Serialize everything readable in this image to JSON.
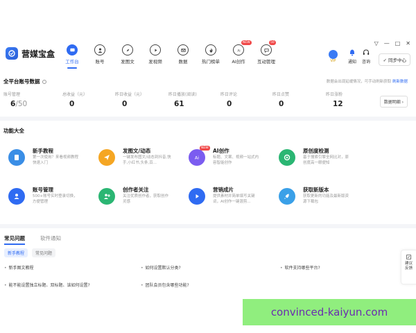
{
  "app": {
    "name": "营媒宝盒"
  },
  "nav": [
    {
      "label": "工作台",
      "icon": "home-monitor-icon",
      "active": true
    },
    {
      "label": "账号",
      "icon": "user-icon"
    },
    {
      "label": "发图文",
      "icon": "compass-icon"
    },
    {
      "label": "发视频",
      "icon": "play-icon"
    },
    {
      "label": "数据",
      "icon": "mail-icon"
    },
    {
      "label": "热门榜单",
      "icon": "fire-icon"
    },
    {
      "label": "AI创作",
      "icon": "ai-icon",
      "badge": "NEW"
    },
    {
      "label": "互动管理",
      "icon": "chat-icon",
      "badge": "50"
    }
  ],
  "toolbar": {
    "window_controls": [
      "▽",
      "—",
      "□",
      "✕"
    ],
    "vip_label": "VIP",
    "notify_label": "通知",
    "consult_label": "咨询",
    "upgrade_label": "✓ 同步中心"
  },
  "stats": {
    "title": "全平台账号数据",
    "note_prefix": "数据会出现延缓情况，可手动刷新获取",
    "note_link": "刷新数据",
    "detail_button": "数据明细 ›",
    "items": [
      {
        "label": "账号管理",
        "value": "6",
        "suffix": "/50",
        "icon": "user-icon"
      },
      {
        "label": "总收益（元）",
        "value": "0",
        "icon": "coin-icon"
      },
      {
        "label": "昨日收益（元）",
        "value": "0",
        "icon": "coin-icon"
      },
      {
        "label": "昨日播放(阅读)",
        "value": "61",
        "icon": "play-icon"
      },
      {
        "label": "昨日评论",
        "value": "0",
        "icon": "comment-icon"
      },
      {
        "label": "昨日点赞",
        "value": "0",
        "icon": "like-icon"
      },
      {
        "label": "昨日涨粉",
        "value": "12",
        "icon": "fans-icon"
      }
    ]
  },
  "features": {
    "title": "功能大全",
    "items": [
      {
        "title": "新手教程",
        "desc": "第一次使用？来看视频教程快速入门",
        "color": "#3a8ee6",
        "icon": "book-icon"
      },
      {
        "title": "发图文/动态",
        "desc": "一键发布图文/动态到抖音,快手,小红书,头条,百...",
        "color": "#f5a623",
        "icon": "send-icon"
      },
      {
        "title": "AI创作",
        "desc": "标题、文案、视频一站式内容智能创作",
        "color": "#7b5cf0",
        "icon": "ai-icon",
        "badge": "NEW"
      },
      {
        "title": "原创度检测",
        "desc": "基于搜索引擎全网比对，原创度高一眼便知",
        "color": "#2bb673",
        "icon": "check-icon"
      },
      {
        "title": "账号管理",
        "desc": "500+账号实时登录切换，方便管理",
        "color": "#2f6bf2",
        "icon": "user-icon"
      },
      {
        "title": "创作者关注",
        "desc": "关注优质创作者，获取创作灵感",
        "color": "#2bb673",
        "icon": "follow-icon"
      },
      {
        "title": "营销成片",
        "desc": "提供素材并简单填写关键词，AI创作一键混剪...",
        "color": "#2f6bf2",
        "icon": "play-icon"
      },
      {
        "title": "获取新版本",
        "desc": "获取更新的功能及最新版资源下载包",
        "color": "#3aa0e8",
        "icon": "rocket-icon"
      }
    ]
  },
  "faq": {
    "tabs": [
      "常见问题",
      "软件通知"
    ],
    "chips": [
      "新手教程",
      "常见问题"
    ],
    "items": [
      "新手图文教程",
      "如何设置默认分类?",
      "软件支持哪些平台?",
      "能不能设置独立标题、双标题、该如何设置?",
      "团队会员包含哪些功能?"
    ]
  },
  "feedback": {
    "label": "建议反馈"
  },
  "watermark": {
    "text": "convinced-kaiyun.com"
  }
}
